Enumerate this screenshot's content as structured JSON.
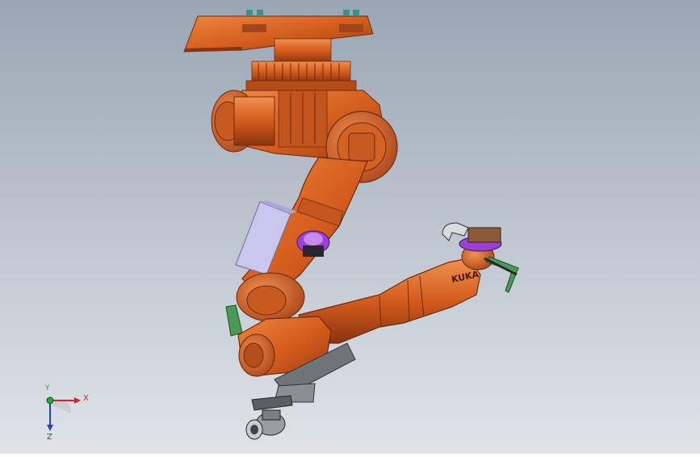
{
  "scene": {
    "background_top": "#9aa6b4",
    "background_bottom": "#dfe3e8",
    "robot_color": "#d35c1c",
    "robot_dark": "#8a3410",
    "robot_light": "#f08a45",
    "accent_purple": "#9b3fd8",
    "tool_gray": "#6f7479",
    "panel_lavender": "#c9c7ee",
    "panel_green": "#4a9a55",
    "arm_lettering": "KUKA"
  },
  "triad": {
    "x_label": "X",
    "y_label": "Y",
    "z_label": "Z",
    "x_color": "#d0272c",
    "y_color": "#1eaa3a",
    "z_color": "#2b3ec4"
  }
}
